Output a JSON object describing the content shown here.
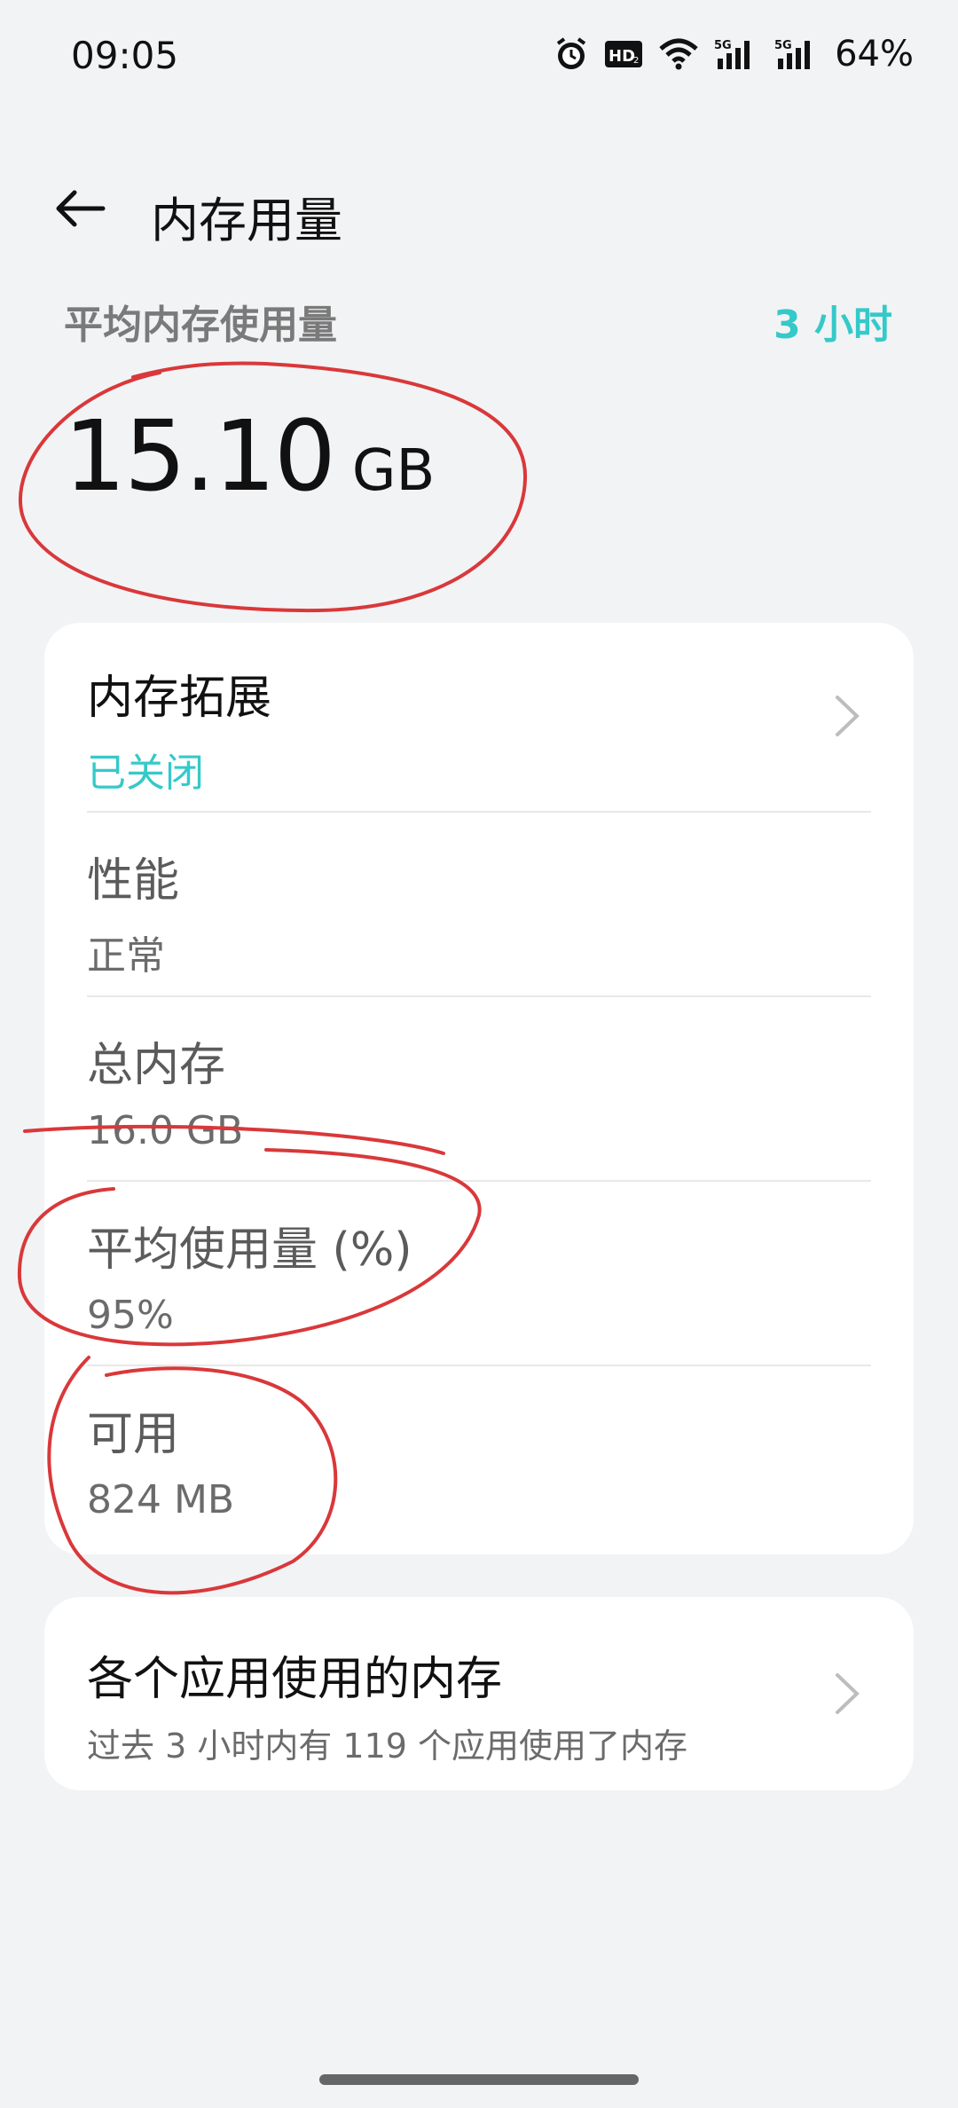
{
  "status_bar": {
    "time": "09:05",
    "battery": "64%",
    "icons": [
      "alarm-icon",
      "hd-icon",
      "wifi-icon",
      "signal-5g-icon",
      "signal-5g-icon"
    ]
  },
  "header": {
    "back_icon": "arrow-left-icon",
    "title": "内存用量"
  },
  "summary": {
    "label": "平均内存使用量",
    "time_range": "3 小时",
    "value": "15.10",
    "unit": "GB"
  },
  "details": [
    {
      "title": "内存拓展",
      "subtitle": "已关闭",
      "has_chevron": true
    },
    {
      "title": "性能",
      "subtitle": "正常",
      "has_chevron": false
    },
    {
      "title": "总内存",
      "subtitle": "16.0 GB",
      "has_chevron": false
    },
    {
      "title": "平均使用量 (%)",
      "subtitle": "95%",
      "has_chevron": false
    },
    {
      "title": "可用",
      "subtitle": "824 MB",
      "has_chevron": false
    }
  ],
  "apps_card": {
    "title": "各个应用使用的内存",
    "subtitle": "过去 3 小时内有 119 个应用使用了内存"
  },
  "colors": {
    "accent": "#35c9c9",
    "background": "#f2f3f5",
    "card": "#ffffff",
    "annotation": "#d9383a"
  }
}
